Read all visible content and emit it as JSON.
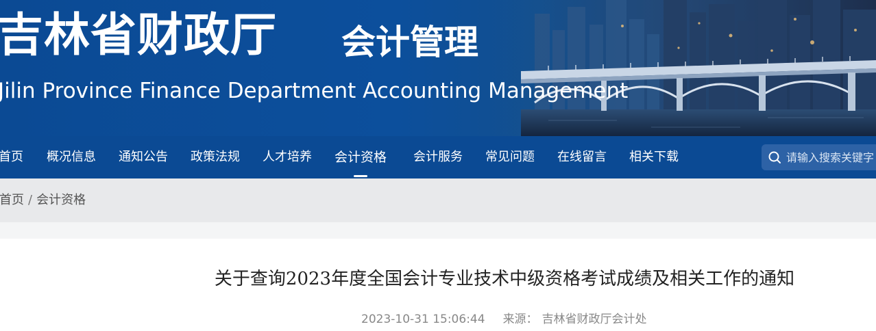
{
  "header": {
    "site_title": "吉林省财政厅",
    "section_title": "会计管理",
    "english_title": "Jilin Province Finance Department Accounting Management"
  },
  "nav": {
    "items": [
      {
        "label": "首页"
      },
      {
        "label": "概况信息"
      },
      {
        "label": "通知公告"
      },
      {
        "label": "政策法规"
      },
      {
        "label": "人才培养"
      },
      {
        "label": "会计资格"
      },
      {
        "label": "会计服务"
      },
      {
        "label": "常见问题"
      },
      {
        "label": "在线留言"
      },
      {
        "label": "相关下载"
      }
    ],
    "active_item": "会计资格",
    "search": {
      "placeholder": "请输入搜索关键字",
      "icon": "search-icon"
    }
  },
  "breadcrumb": {
    "home": "首页",
    "separator": "/",
    "current": "会计资格"
  },
  "article": {
    "title": "关于查询2023年度全国会计专业技术中级资格考试成绩及相关工作的通知",
    "date": "2023-10-31 15:06:44",
    "source_label": "来源：",
    "source": "吉林省财政厅会计处"
  },
  "colors": {
    "banner_blue": "#0b4a94",
    "nav_blue": "#0b4a94",
    "breadcrumb_bg": "#e8e9eb",
    "title_text": "#222222",
    "meta_text": "#888888"
  }
}
